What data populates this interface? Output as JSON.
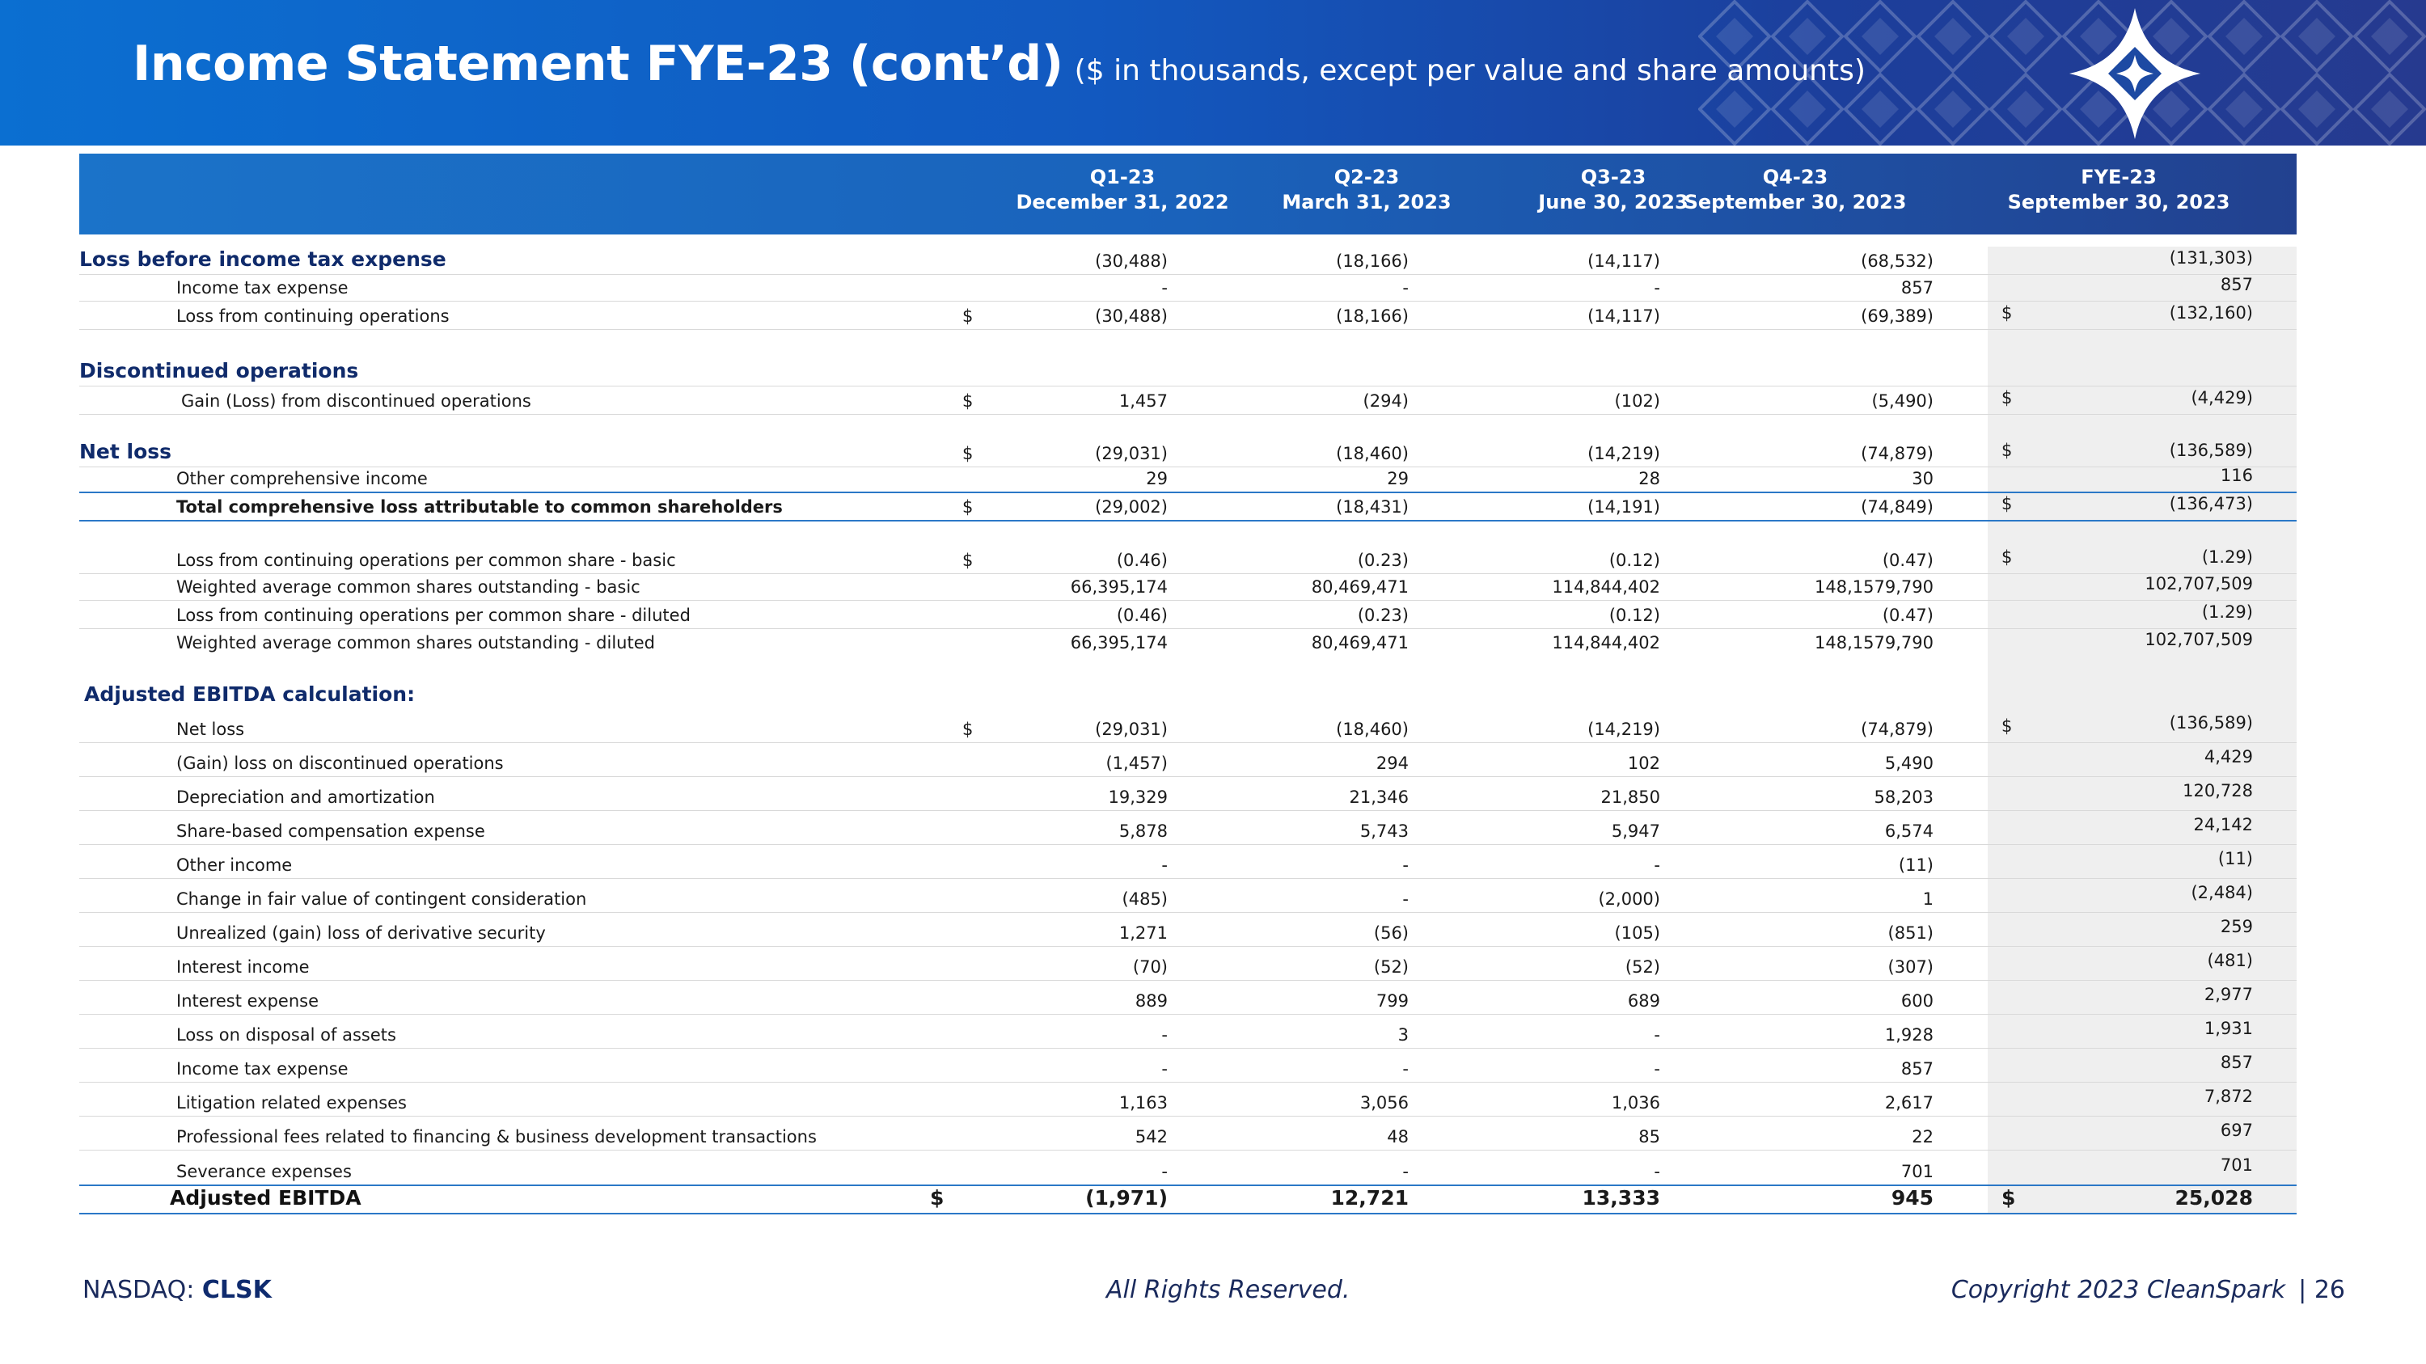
{
  "header": {
    "title": "Income Statement FYE-23 (cont’d)",
    "subtitle": "($ in thousands, except per value and share amounts)"
  },
  "colors": {
    "accent": "#1b73c9",
    "section_text": "#102b6b",
    "rule_blue": "#2b78c7"
  },
  "columns": [
    {
      "line1": "Q1-23",
      "line2": "December 31, 2022"
    },
    {
      "line1": "Q2-23",
      "line2": "March 31, 2023"
    },
    {
      "line1": "Q3-23",
      "line2": "June 30, 2023"
    },
    {
      "line1": "Q4-23",
      "line2": "September 30, 2023"
    },
    {
      "line1": "FYE-23",
      "line2": "September 30, 2023"
    }
  ],
  "rows": [
    {
      "label": "Loss before income tax expense",
      "values": [
        "(30,488)",
        "(18,166)",
        "(14,117)",
        "(68,532)",
        "(131,303)"
      ]
    },
    {
      "label": "Income tax expense",
      "values": [
        "-",
        "-",
        "-",
        "857",
        "857"
      ]
    },
    {
      "label": "Loss from continuing operations",
      "dollar": "$",
      "values": [
        "(30,488)",
        "(18,166)",
        "(14,117)",
        "(69,389)",
        "(132,160)"
      ],
      "dollar_fye": "$"
    },
    {
      "label": "Discontinued operations"
    },
    {
      "label": "Gain (Loss) from discontinued operations",
      "dollar": "$",
      "values": [
        "1,457",
        "(294)",
        "(102)",
        "(5,490)",
        "(4,429)"
      ],
      "dollar_fye": "$"
    },
    {
      "label": "Net loss",
      "dollar": "$",
      "values": [
        "(29,031)",
        "(18,460)",
        "(14,219)",
        "(74,879)",
        "(136,589)"
      ],
      "dollar_fye": "$"
    },
    {
      "label": "Other comprehensive income",
      "values": [
        "29",
        "29",
        "28",
        "30",
        "116"
      ]
    },
    {
      "label": "Total comprehensive loss attributable to common shareholders",
      "dollar": "$",
      "values": [
        "(29,002)",
        "(18,431)",
        "(14,191)",
        "(74,849)",
        "(136,473)"
      ],
      "dollar_fye": "$"
    },
    {
      "label": "Loss from continuing operations per common share - basic",
      "dollar": "$",
      "values": [
        "(0.46)",
        "(0.23)",
        "(0.12)",
        "(0.47)",
        "(1.29)"
      ],
      "dollar_fye": "$"
    },
    {
      "label": "Weighted average common shares outstanding - basic",
      "values": [
        "66,395,174",
        "80,469,471",
        "114,844,402",
        "148,1579,790",
        "102,707,509"
      ]
    },
    {
      "label": "Loss from continuing operations per common share - diluted",
      "values": [
        "(0.46)",
        "(0.23)",
        "(0.12)",
        "(0.47)",
        "(1.29)"
      ]
    },
    {
      "label": "Weighted average common shares outstanding - diluted",
      "values": [
        "66,395,174",
        "80,469,471",
        "114,844,402",
        "148,1579,790",
        "102,707,509"
      ]
    },
    {
      "label": "Adjusted EBITDA calculation:"
    },
    {
      "label": "Net loss",
      "dollar": "$",
      "values": [
        "(29,031)",
        "(18,460)",
        "(14,219)",
        "(74,879)",
        "(136,589)"
      ],
      "dollar_fye": "$"
    },
    {
      "label": "(Gain) loss on discontinued operations",
      "values": [
        "(1,457)",
        "294",
        "102",
        "5,490",
        "4,429"
      ]
    },
    {
      "label": "Depreciation and amortization",
      "values": [
        "19,329",
        "21,346",
        "21,850",
        "58,203",
        "120,728"
      ]
    },
    {
      "label": "Share-based compensation expense",
      "values": [
        "5,878",
        "5,743",
        "5,947",
        "6,574",
        "24,142"
      ]
    },
    {
      "label": "Other income",
      "values": [
        "-",
        "-",
        "-",
        "(11)",
        "(11)"
      ]
    },
    {
      "label": "Change in fair value of contingent consideration",
      "values": [
        "(485)",
        "-",
        "(2,000)",
        "1",
        "(2,484)"
      ]
    },
    {
      "label": "Unrealized (gain) loss of derivative security",
      "values": [
        "1,271",
        "(56)",
        "(105)",
        "(851)",
        "259"
      ]
    },
    {
      "label": "Interest income",
      "values": [
        "(70)",
        "(52)",
        "(52)",
        "(307)",
        "(481)"
      ]
    },
    {
      "label": "Interest expense",
      "values": [
        "889",
        "799",
        "689",
        "600",
        "2,977"
      ]
    },
    {
      "label": "Loss on disposal of assets",
      "values": [
        "-",
        "3",
        "-",
        "1,928",
        "1,931"
      ]
    },
    {
      "label": "Income tax expense",
      "values": [
        "-",
        "-",
        "-",
        "857",
        "857"
      ]
    },
    {
      "label": "Litigation related expenses",
      "values": [
        "1,163",
        "3,056",
        "1,036",
        "2,617",
        "7,872"
      ]
    },
    {
      "label": "Professional fees related to financing & business development transactions",
      "values": [
        "542",
        "48",
        "85",
        "22",
        "697"
      ]
    },
    {
      "label": "Severance expenses",
      "values": [
        "-",
        "-",
        "-",
        "701",
        "701"
      ]
    },
    {
      "label": "Adjusted EBITDA",
      "dollar": "$",
      "values": [
        "(1,971)",
        "12,721",
        "13,333",
        "945",
        "25,028"
      ],
      "dollar_fye": "$"
    }
  ],
  "footer": {
    "exchange_prefix": "NASDAQ:",
    "ticker": "CLSK",
    "rights": "All Rights Reserved.",
    "copyright": "Copyright 2023 CleanSpark",
    "page_sep": "|",
    "page_number": "26"
  }
}
